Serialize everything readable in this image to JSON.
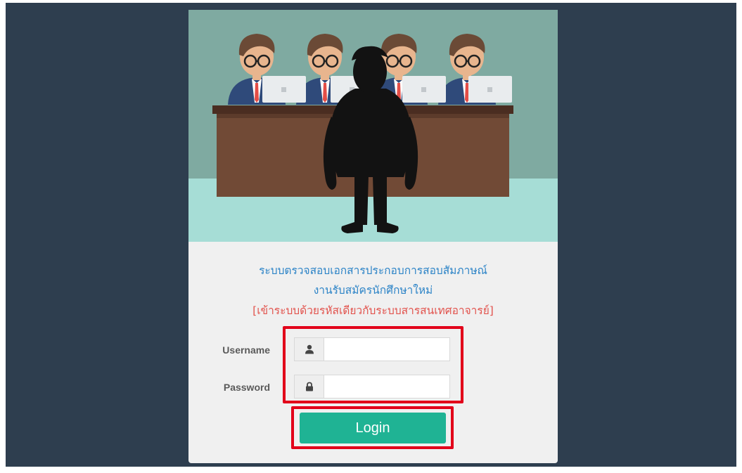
{
  "form": {
    "title_line1": "ระบบตรวจสอบเอกสารประกอบการสอบสัมภาษณ์",
    "title_line2": "งานรับสมัครนักศึกษาใหม่",
    "notice": "[เข้าระบบด้วยรหัสเดียวกับระบบสารสนเทศอาจารย์]",
    "username_label": "Username",
    "password_label": "Password",
    "username_value": "",
    "password_value": "",
    "login_label": "Login"
  },
  "icons": {
    "username": "user-icon",
    "password": "lock-icon"
  },
  "colors": {
    "page_background": "#2e3e4f",
    "title": "#2d84c7",
    "notice": "#e2544e",
    "login_button": "#1fb394",
    "highlight": "#e2001a"
  }
}
